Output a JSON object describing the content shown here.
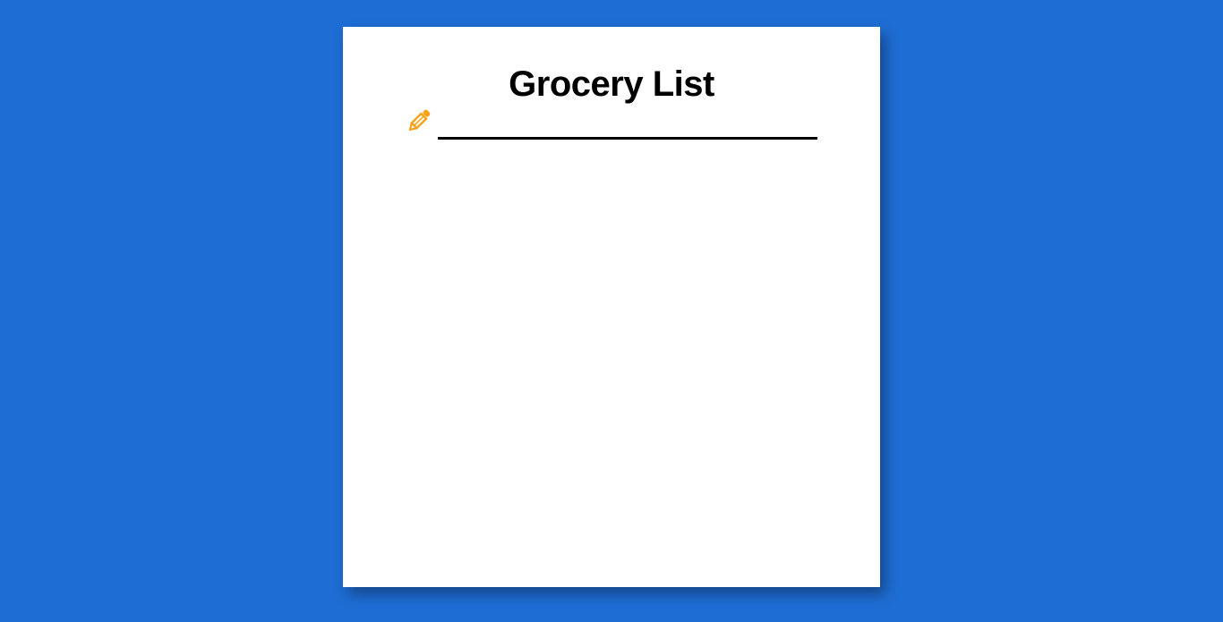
{
  "header": {
    "title": "Grocery List"
  },
  "input": {
    "value": "",
    "placeholder": ""
  },
  "icons": {
    "edit": "pencil-icon"
  },
  "colors": {
    "background": "#1e6dd4",
    "card": "#ffffff",
    "accent": "#f5a31a",
    "text": "#000000"
  },
  "items": []
}
